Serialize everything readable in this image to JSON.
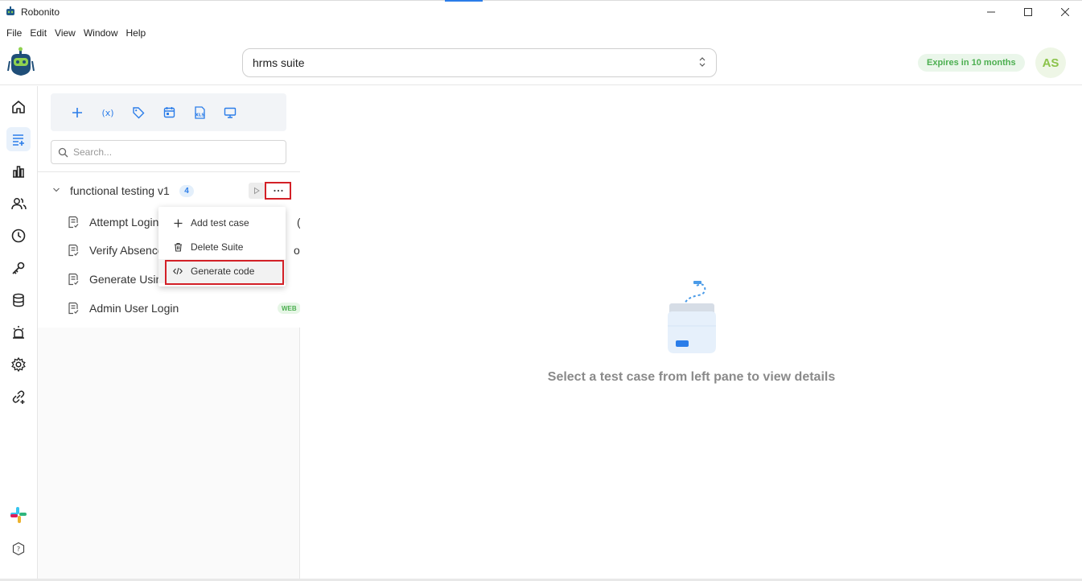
{
  "window": {
    "title": "Robonito",
    "controls": [
      "minimize-icon",
      "maximize-icon",
      "close-icon"
    ]
  },
  "menu": [
    "File",
    "Edit",
    "View",
    "Window",
    "Help"
  ],
  "header": {
    "suite_selected": "hrms suite",
    "expiry_text": "Expires in 10 months",
    "avatar_initials": "AS"
  },
  "sidebar": {
    "icons": [
      "home-icon",
      "test-list-icon",
      "bar-chart-icon",
      "users-icon",
      "clock-icon",
      "key-icon",
      "database-icon",
      "alarm-icon",
      "settings-icon",
      "integration-icon",
      "slack-icon",
      "help-icon"
    ],
    "active": "test-list-icon"
  },
  "panel": {
    "toolbar": [
      "add-icon",
      "variable-icon",
      "tag-icon",
      "calendar-icon",
      "excel-icon",
      "monitor-icon"
    ],
    "search_placeholder": "Search...",
    "suite": {
      "name": "functional testing v1",
      "count": "4"
    },
    "test_cases": [
      {
        "name": "Attempt Login",
        "trailing": "(D"
      },
      {
        "name": "Verify Absence",
        "trailing": "ord"
      },
      {
        "name": "Generate Usin",
        "trailing": ""
      },
      {
        "name": "Admin User Login",
        "badge": "WEB"
      }
    ]
  },
  "context_menu": {
    "items": [
      {
        "icon": "plus-icon",
        "label": "Add test case"
      },
      {
        "icon": "trash-icon",
        "label": "Delete Suite"
      },
      {
        "icon": "code-icon",
        "label": "Generate code"
      }
    ],
    "highlighted": "Generate code"
  },
  "main": {
    "empty_message": "Select a test case from left pane to view details"
  },
  "colors": {
    "accent": "#2b7de9",
    "highlight_box": "#d32027",
    "badge_green": "#4caf50"
  }
}
